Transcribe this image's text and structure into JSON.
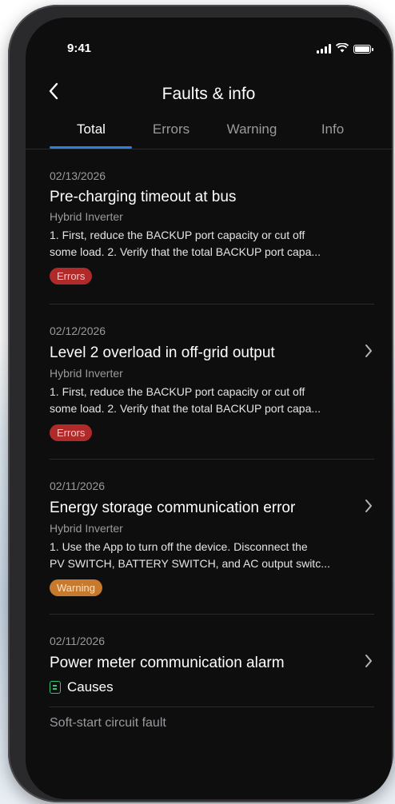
{
  "status_bar": {
    "time": "9:41"
  },
  "nav": {
    "title": "Faults & info"
  },
  "tabs": [
    {
      "label": "Total",
      "active": true
    },
    {
      "label": "Errors",
      "active": false
    },
    {
      "label": "Warning",
      "active": false
    },
    {
      "label": "Info",
      "active": false
    }
  ],
  "items": [
    {
      "date": "02/13/2026",
      "title": "Pre-charging timeout at bus",
      "device": "Hybrid Inverter",
      "desc_line1": "1. First, reduce the BACKUP port capacity or cut off",
      "desc_line2": "some load. 2. Verify that the total BACKUP port capa...",
      "badge": "Errors"
    },
    {
      "date": "02/12/2026",
      "title": "Level 2 overload in off-grid output",
      "device": "Hybrid Inverter",
      "desc_line1": "1. First, reduce the BACKUP port capacity or cut off",
      "desc_line2": "some load. 2. Verify that the total BACKUP port capa...",
      "badge": "Errors"
    },
    {
      "date": "02/11/2026",
      "title": "Energy storage communication error",
      "device": "Hybrid Inverter",
      "desc_line1": "1. Use the App to turn off the device. Disconnect the",
      "desc_line2": "PV SWITCH, BATTERY SWITCH, and AC output switc...",
      "badge": "Warning"
    },
    {
      "date": "02/11/2026",
      "title": "Power meter communication alarm",
      "causes_label": "Causes",
      "cause_item": "Soft-start circuit fault"
    }
  ],
  "colors": {
    "accent": "#2f7fe0",
    "error": "#b02a2a",
    "warning": "#c77a2e",
    "causes": "#35c47a"
  },
  "icons": [
    "back-chevron-icon",
    "chevron-right-icon",
    "signal-icon",
    "wifi-icon",
    "battery-icon",
    "causes-list-icon"
  ]
}
